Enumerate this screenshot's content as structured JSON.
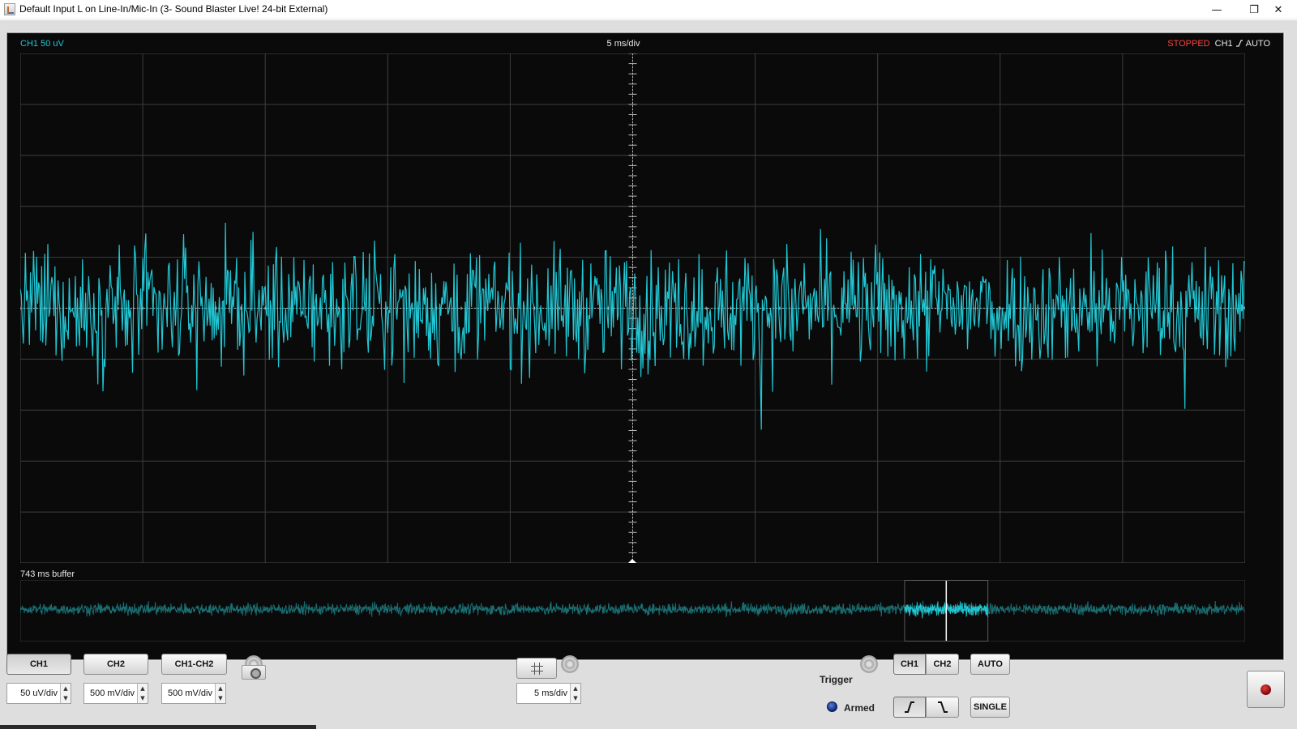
{
  "window": {
    "title": "Default Input L on Line-In/Mic-In (3- Sound Blaster Live! 24-bit External)",
    "controls": {
      "minimize": "—",
      "restore": "❐",
      "close": "✕"
    }
  },
  "scope": {
    "ch1_scale": "CH1 50 uV",
    "timebase": "5 ms/div",
    "status": {
      "state": "STOPPED",
      "channel": "CH1",
      "mode": "AUTO"
    },
    "buffer_label": "743 ms buffer",
    "trace_color": "#21c7d4",
    "buffer_trace_color": "#1a6e72",
    "grid_divisions": {
      "horizontal": 10,
      "vertical": 10
    },
    "buffer_window": {
      "start": 0.722,
      "end": 0.79,
      "cursor": 0.756
    }
  },
  "controls": {
    "channel_buttons": [
      "CH1",
      "CH2",
      "CH1-CH2"
    ],
    "ch1_volts": "50 uV/div",
    "ch2_volts": "500 mV/div",
    "diff_volts": "500 mV/div",
    "timebase_value": "5 ms/div",
    "trigger": {
      "label": "Trigger",
      "source": [
        "CH1",
        "CH2"
      ],
      "auto": "AUTO",
      "single": "SINGLE",
      "armed": "Armed"
    },
    "spinner_up": "▲",
    "spinner_down": "▼"
  },
  "icons": [
    "app-icon",
    "gear-icon",
    "camera-icon",
    "grid-icon",
    "record-icon",
    "rising-edge-icon",
    "falling-edge-icon",
    "armed-led-icon"
  ]
}
